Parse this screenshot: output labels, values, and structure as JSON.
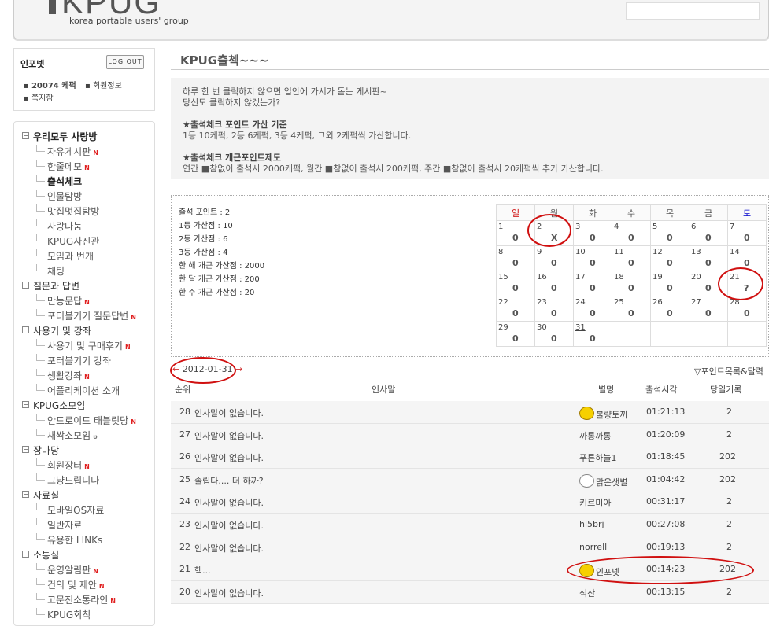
{
  "header": {
    "logo": "KPUG",
    "tagline": "korea portable users' group"
  },
  "login": {
    "title": "인포넷",
    "logout": "LOG OUT",
    "points": "20074 케퍽",
    "member_info": "회원정보",
    "messages": "쪽지함"
  },
  "nav": [
    {
      "label": "우리모두 사랑방",
      "type": "cat",
      "bold": true
    },
    {
      "label": "자유게시판",
      "new": true
    },
    {
      "label": "한줄메모",
      "new": true
    },
    {
      "label": "출석체크",
      "bold": true
    },
    {
      "label": "인물탐방"
    },
    {
      "label": "맛집멋집탐방"
    },
    {
      "label": "사랑나눔"
    },
    {
      "label": "KPUG사진관"
    },
    {
      "label": "모임과 번개"
    },
    {
      "label": "채팅"
    },
    {
      "label": "질문과 답변",
      "type": "cat"
    },
    {
      "label": "만능문답",
      "new": true
    },
    {
      "label": "포터블기기 질문답변",
      "new": true
    },
    {
      "label": "사용기 및 강좌",
      "type": "cat"
    },
    {
      "label": "사용기 및 구매후기",
      "new": true
    },
    {
      "label": "포터블기기 강좌"
    },
    {
      "label": "생활강좌",
      "new": true
    },
    {
      "label": "어플리케이션 소개"
    },
    {
      "label": "KPUG소모임",
      "type": "cat"
    },
    {
      "label": "안드로이드 태블릿당",
      "new": true
    },
    {
      "label": "새싹소모임",
      "u": true
    },
    {
      "label": "장마당",
      "type": "cat"
    },
    {
      "label": "회원장터",
      "new": true
    },
    {
      "label": "그냥드립니다"
    },
    {
      "label": "자료실",
      "type": "cat"
    },
    {
      "label": "모바일OS자료"
    },
    {
      "label": "일반자료"
    },
    {
      "label": "유용한 LINKs"
    },
    {
      "label": "소통실",
      "type": "cat"
    },
    {
      "label": "운영알림판",
      "new": true
    },
    {
      "label": "건의 및 제안",
      "new": true
    },
    {
      "label": "고문진소통라인",
      "new": true
    },
    {
      "label": "KPUG회칙"
    }
  ],
  "page_title": "KPUG출첵~~~",
  "description": [
    {
      "text": "하루 한 번 클릭하지 않으면 입안에 가시가 돋는 게시판~",
      "bold": false
    },
    {
      "text": "당신도 클릭하지 않겠는가?",
      "bold": false
    },
    {
      "text": "",
      "bold": false
    },
    {
      "text": "★출석체크 포인트 가산 기준",
      "bold": true
    },
    {
      "text": "1등 10케퍽, 2등 6케퍽, 3등 4케퍽, 그외 2케퍽씩 가산합니다.",
      "bold": false
    },
    {
      "text": "",
      "bold": false
    },
    {
      "text": "★출석체크 개근포인트제도",
      "bold": true
    },
    {
      "text": "연간 ■참없이 출석시 2000케퍽, 월간 ■참없이 출석시 200케퍽, 주간 ■참없이 출석시 20케퍽씩 추가 가산합니다.",
      "bold": false
    }
  ],
  "stats": [
    "출석 포인트 : 2",
    "1등 가산점 : 10",
    "2등 가산점 : 6",
    "3등 가산점 : 4",
    "한 해 개근 가산점 : 2000",
    "한 달 개근 가산점 : 200",
    "한 주 개근 가산점 : 20"
  ],
  "calendar": {
    "weekdays": [
      "일",
      "월",
      "화",
      "수",
      "목",
      "금",
      "토"
    ],
    "weeks": [
      [
        {
          "d": "1",
          "v": "0"
        },
        {
          "d": "2",
          "v": "X"
        },
        {
          "d": "3",
          "v": "0"
        },
        {
          "d": "4",
          "v": "0"
        },
        {
          "d": "5",
          "v": "0"
        },
        {
          "d": "6",
          "v": "0"
        },
        {
          "d": "7",
          "v": "0"
        }
      ],
      [
        {
          "d": "8",
          "v": "0"
        },
        {
          "d": "9",
          "v": "0"
        },
        {
          "d": "10",
          "v": "0"
        },
        {
          "d": "11",
          "v": "0"
        },
        {
          "d": "12",
          "v": "0"
        },
        {
          "d": "13",
          "v": "0"
        },
        {
          "d": "14",
          "v": "0"
        }
      ],
      [
        {
          "d": "15",
          "v": "0"
        },
        {
          "d": "16",
          "v": "0"
        },
        {
          "d": "17",
          "v": "0"
        },
        {
          "d": "18",
          "v": "0"
        },
        {
          "d": "19",
          "v": "0"
        },
        {
          "d": "20",
          "v": "0"
        },
        {
          "d": "21",
          "v": "?"
        }
      ],
      [
        {
          "d": "22",
          "v": "0"
        },
        {
          "d": "23",
          "v": "0"
        },
        {
          "d": "24",
          "v": "0"
        },
        {
          "d": "25",
          "v": "0"
        },
        {
          "d": "26",
          "v": "0"
        },
        {
          "d": "27",
          "v": "0"
        },
        {
          "d": "28",
          "v": "0"
        }
      ],
      [
        {
          "d": "29",
          "v": "0"
        },
        {
          "d": "30",
          "v": "0"
        },
        {
          "d": "31",
          "v": "0"
        },
        {
          "d": "",
          "v": ""
        },
        {
          "d": "",
          "v": ""
        },
        {
          "d": "",
          "v": ""
        },
        {
          "d": "",
          "v": ""
        }
      ]
    ]
  },
  "list": {
    "date": "2012-01-31",
    "points_link": "▽포인트목록&달력",
    "headers": {
      "rank": "순위",
      "greeting": "인사말",
      "nick": "별명",
      "time": "출석시각",
      "daily": "당일기록"
    },
    "rows": [
      {
        "rank": "28",
        "greeting": "인사말이 없습니다.",
        "nick": "불량토끼",
        "time": "01:21:13",
        "daily": "2",
        "icon": "yellow"
      },
      {
        "rank": "27",
        "greeting": "인사말이 없습니다.",
        "nick": "까롱까롱",
        "time": "01:20:09",
        "daily": "2",
        "icon": ""
      },
      {
        "rank": "26",
        "greeting": "인사말이 없습니다.",
        "nick": "푸른하늘1",
        "time": "01:18:45",
        "daily": "202",
        "icon": ""
      },
      {
        "rank": "25",
        "greeting": "졸립다.... 더 하까?",
        "nick": "맑은샛별",
        "time": "01:04:42",
        "daily": "202",
        "icon": "star"
      },
      {
        "rank": "24",
        "greeting": "인사말이 없습니다.",
        "nick": "키르미아",
        "time": "00:31:17",
        "daily": "2",
        "icon": ""
      },
      {
        "rank": "23",
        "greeting": "인사말이 없습니다.",
        "nick": "hl5brj",
        "time": "00:27:08",
        "daily": "2",
        "icon": ""
      },
      {
        "rank": "22",
        "greeting": "인사말이 없습니다.",
        "nick": "norrell",
        "time": "00:19:13",
        "daily": "2",
        "icon": ""
      },
      {
        "rank": "21",
        "greeting": "헥...",
        "nick": "인포넷",
        "time": "00:14:23",
        "daily": "202",
        "icon": "yellow"
      },
      {
        "rank": "20",
        "greeting": "인사말이 없습니다.",
        "nick": "석산",
        "time": "00:13:15",
        "daily": "2",
        "icon": ""
      }
    ]
  }
}
